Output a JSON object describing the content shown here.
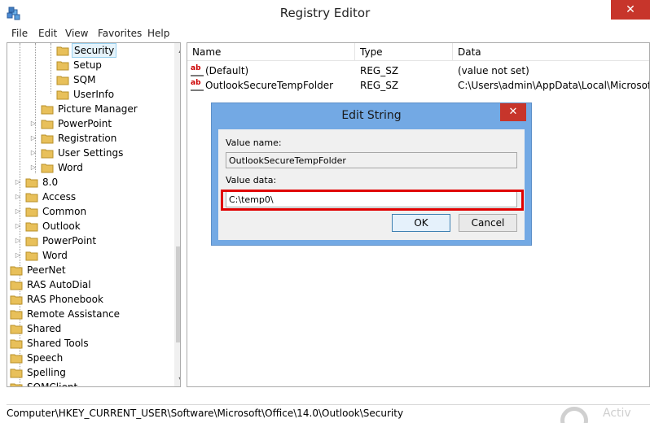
{
  "window": {
    "title": "Registry Editor",
    "close_glyph": "✕"
  },
  "menu": {
    "items": [
      "File",
      "Edit",
      "View",
      "Favorites",
      "Help"
    ]
  },
  "tree": {
    "items": [
      {
        "label": "Security",
        "selected": true
      },
      {
        "label": "Setup"
      },
      {
        "label": "SQM"
      },
      {
        "label": "UserInfo"
      },
      {
        "label": "Picture Manager"
      },
      {
        "label": "PowerPoint"
      },
      {
        "label": "Registration"
      },
      {
        "label": "User Settings"
      },
      {
        "label": "Word"
      },
      {
        "label": "8.0"
      },
      {
        "label": "Access"
      },
      {
        "label": "Common"
      },
      {
        "label": "Outlook"
      },
      {
        "label": "PowerPoint"
      },
      {
        "label": "Word"
      },
      {
        "label": "PeerNet"
      },
      {
        "label": "RAS AutoDial"
      },
      {
        "label": "RAS Phonebook"
      },
      {
        "label": "Remote Assistance"
      },
      {
        "label": "Shared"
      },
      {
        "label": "Shared Tools"
      },
      {
        "label": "Speech"
      },
      {
        "label": "Spelling"
      },
      {
        "label": "SQMClient"
      }
    ],
    "folder_color": "#e8c05a",
    "selected_bg": "#e5f3fb"
  },
  "list": {
    "columns": [
      "Name",
      "Type",
      "Data"
    ],
    "rows": [
      {
        "name": "(Default)",
        "type": "REG_SZ",
        "data": "(value not set)"
      },
      {
        "name": "OutlookSecureTempFolder",
        "type": "REG_SZ",
        "data": "C:\\Users\\admin\\AppData\\Local\\Microsoft\\"
      }
    ],
    "row_icon": "ab"
  },
  "dialog": {
    "title": "Edit String",
    "close_glyph": "✕",
    "value_name_label": "Value name:",
    "value_name": "OutlookSecureTempFolder",
    "value_data_label": "Value data:",
    "value_data": "C:\\temp0\\",
    "ok_label": "OK",
    "cancel_label": "Cancel",
    "highlight_color": "#e00000",
    "frame_color": "#73a9e4"
  },
  "status": {
    "path": "Computer\\HKEY_CURRENT_USER\\Software\\Microsoft\\Office\\14.0\\Outlook\\Security"
  },
  "watermark": {
    "text": "Activ"
  }
}
